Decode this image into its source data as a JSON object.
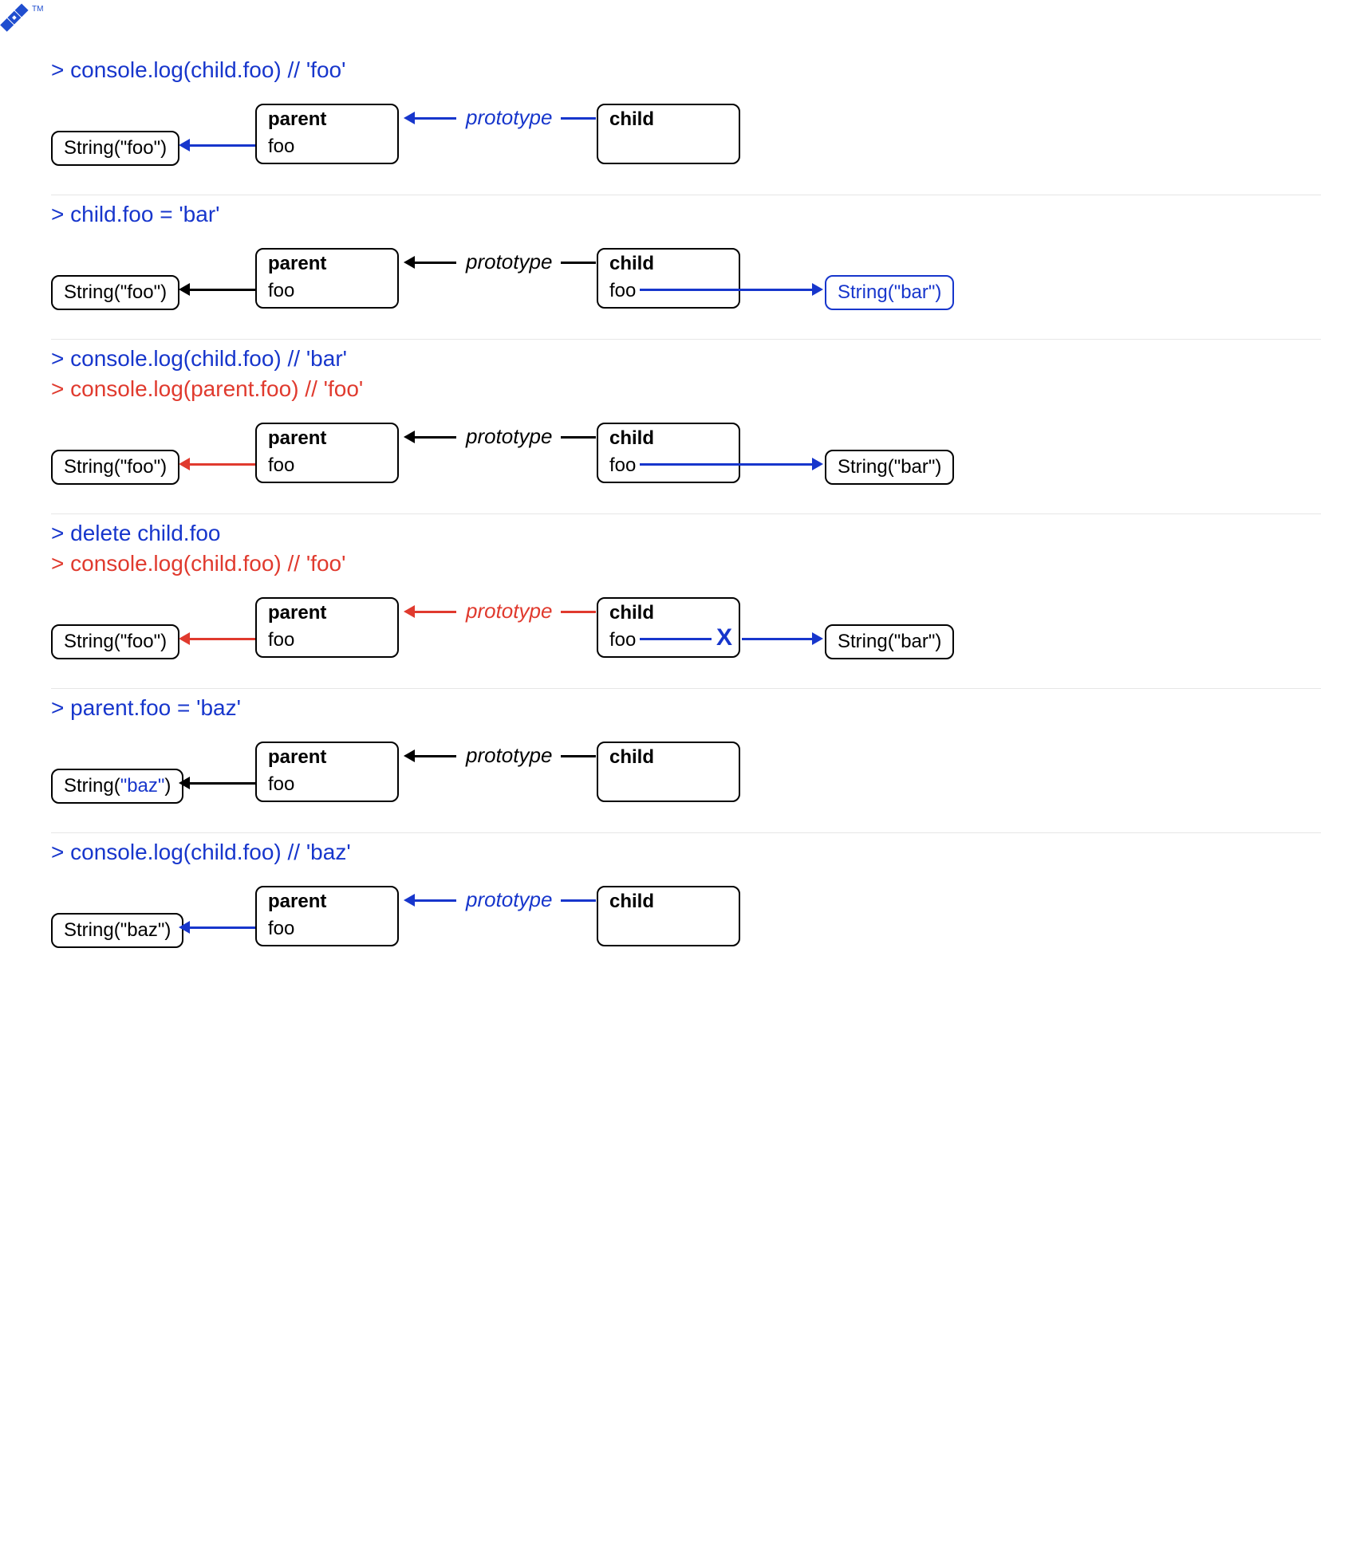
{
  "logo_tm": "TM",
  "labels": {
    "parent": "parent",
    "child": "child",
    "foo": "foo",
    "prototype": "prototype",
    "x": "X"
  },
  "strings": {
    "foo": "String(\"foo\")",
    "bar": "String(\"bar\")",
    "baz_prefix": "String(",
    "baz_val": "\"baz\"",
    "baz_suffix": ")"
  },
  "sections": {
    "s1": {
      "cmd": "> console.log(child.foo) // 'foo'"
    },
    "s2": {
      "cmd": "> child.foo = 'bar'"
    },
    "s3": {
      "cmd1": "> console.log(child.foo) // 'bar'",
      "cmd2": "> console.log(parent.foo) // 'foo'"
    },
    "s4": {
      "cmd1": "> delete child.foo",
      "cmd2": "> console.log(child.foo) // 'foo'"
    },
    "s5": {
      "cmd": "> parent.foo = 'baz'"
    },
    "s6": {
      "cmd": "> console.log(child.foo) // 'baz'"
    }
  }
}
